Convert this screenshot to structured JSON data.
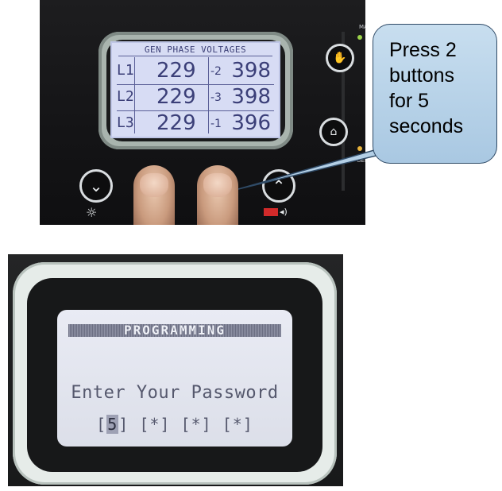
{
  "top_display": {
    "header": "GEN  PHASE  VOLTAGES",
    "rows": [
      {
        "phase": "L1",
        "voltage": "229",
        "pair": "-2",
        "line_voltage": "398"
      },
      {
        "phase": "L2",
        "voltage": "229",
        "pair": "-3",
        "line_voltage": "398"
      },
      {
        "phase": "L3",
        "voltage": "229",
        "pair": "-1",
        "line_voltage": "396"
      }
    ]
  },
  "callout": {
    "lines": [
      "Press 2",
      "buttons",
      "for 5",
      "seconds"
    ]
  },
  "bottom_display": {
    "title": "PROGRAMMING",
    "prompt": "Enter Your Password",
    "password_slots": [
      "[",
      "5",
      "]",
      " [*]",
      " [*]",
      " [*]"
    ]
  },
  "icons": {
    "down_button": "chevron-down-icon",
    "up_button": "chevron-up-icon",
    "lamp": "lamp-test-icon",
    "mute": "horn-mute-icon",
    "manual": "hand-icon"
  },
  "colors": {
    "lcd_blue": "#d7dcf4",
    "callout_fill": "#b9d3ea",
    "callout_border": "#2f4a66"
  }
}
